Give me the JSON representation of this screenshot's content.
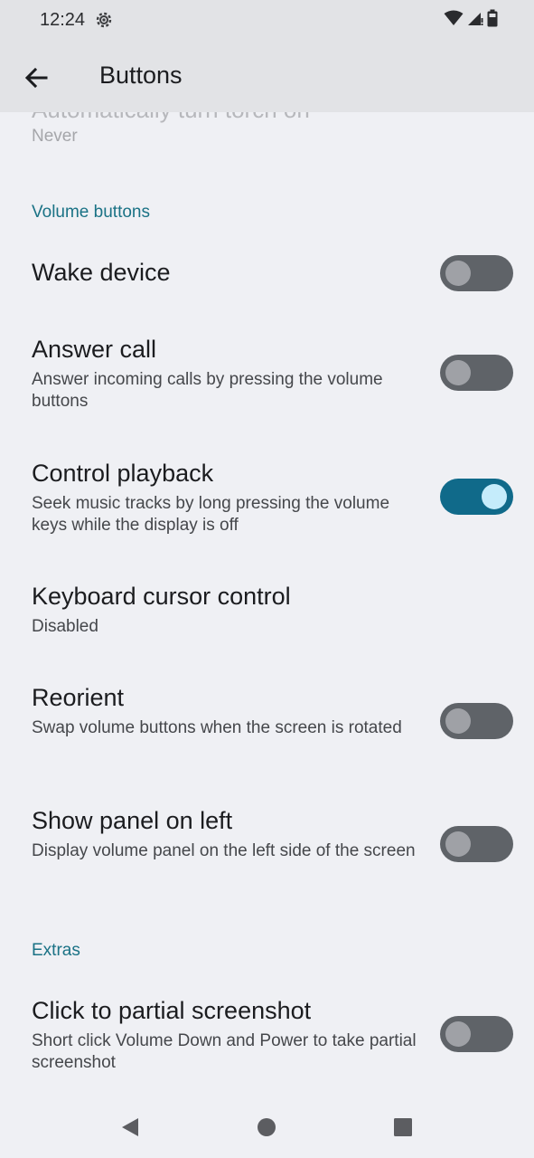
{
  "status_bar": {
    "time": "12:24",
    "icons": [
      "gear-icon",
      "wifi-icon",
      "signal-icon",
      "battery-icon"
    ]
  },
  "app_bar": {
    "title": "Buttons",
    "back_icon": "arrow-left-icon"
  },
  "partial_item": {
    "title": "Automatically turn torch on",
    "summary": "Never"
  },
  "sections": {
    "volume": {
      "header": "Volume buttons"
    },
    "extras": {
      "header": "Extras"
    }
  },
  "items": {
    "wake_device": {
      "title": "Wake device",
      "summary": "",
      "checked": false
    },
    "answer_call": {
      "title": "Answer call",
      "summary": "Answer incoming calls by pressing the volume buttons",
      "checked": false
    },
    "control_playback": {
      "title": "Control playback",
      "summary": "Seek music tracks by long pressing the volume keys while the display is off",
      "checked": true
    },
    "keyboard_cursor": {
      "title": "Keyboard cursor control",
      "summary": "Disabled"
    },
    "reorient": {
      "title": "Reorient",
      "summary": "Swap volume buttons when the screen is rotated",
      "checked": false
    },
    "show_panel_left": {
      "title": "Show panel on left",
      "summary": "Display volume panel on the left side of the screen",
      "checked": false
    },
    "partial_screenshot": {
      "title": "Click to partial screenshot",
      "summary": "Short click Volume Down and Power to take partial screenshot",
      "checked": false
    }
  },
  "nav_bar": {
    "icons": [
      "back-triangle-icon",
      "home-circle-icon",
      "recents-square-icon"
    ]
  },
  "colors": {
    "background": "#eff0f4",
    "app_bar": "#e2e3e6",
    "accent": "#1a7285",
    "switch_on_track": "#106a8a",
    "switch_on_thumb": "#c5ecfb",
    "switch_off_track": "#5f6368",
    "switch_off_thumb": "#9fa1a6"
  }
}
